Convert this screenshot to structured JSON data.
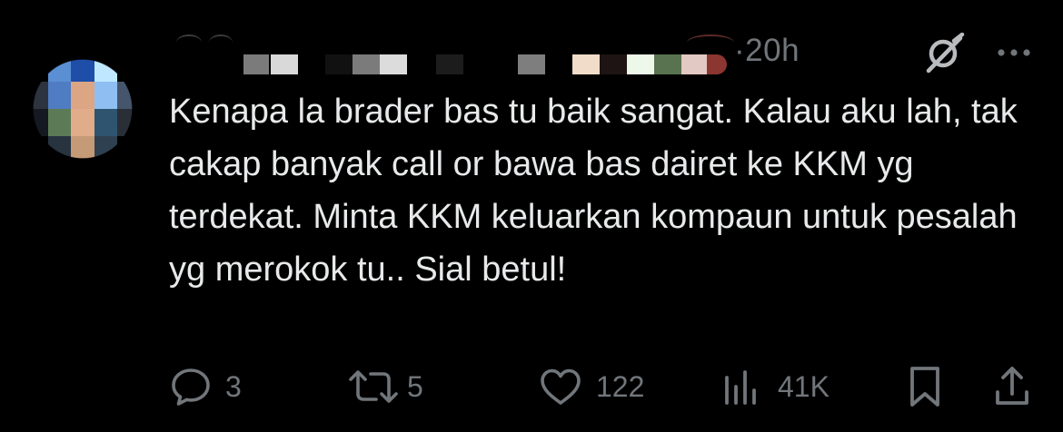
{
  "tweet": {
    "timestamp_separator": "·",
    "timestamp": "20h",
    "text": "Kenapa la brader bas tu baik sangat. Kalau aku lah, tak cakap banyak call or bawa bas dairet ke KKM yg terdekat. Minta KKM keluarkan kompaun untuk pesalah yg merokok tu.. Sial betul!",
    "icons": {
      "grok": "grok-icon",
      "more": "more-options-icon"
    }
  },
  "actions": {
    "reply": {
      "icon": "reply-icon",
      "count": "3"
    },
    "retweet": {
      "icon": "retweet-icon",
      "count": "5"
    },
    "like": {
      "icon": "heart-icon",
      "count": "122"
    },
    "views": {
      "icon": "views-icon",
      "count": "41K"
    },
    "bookmark": {
      "icon": "bookmark-icon"
    },
    "share": {
      "icon": "share-icon"
    }
  },
  "colors": {
    "background": "#000000",
    "text_primary": "#e7e9ea",
    "text_secondary": "#71767b"
  }
}
